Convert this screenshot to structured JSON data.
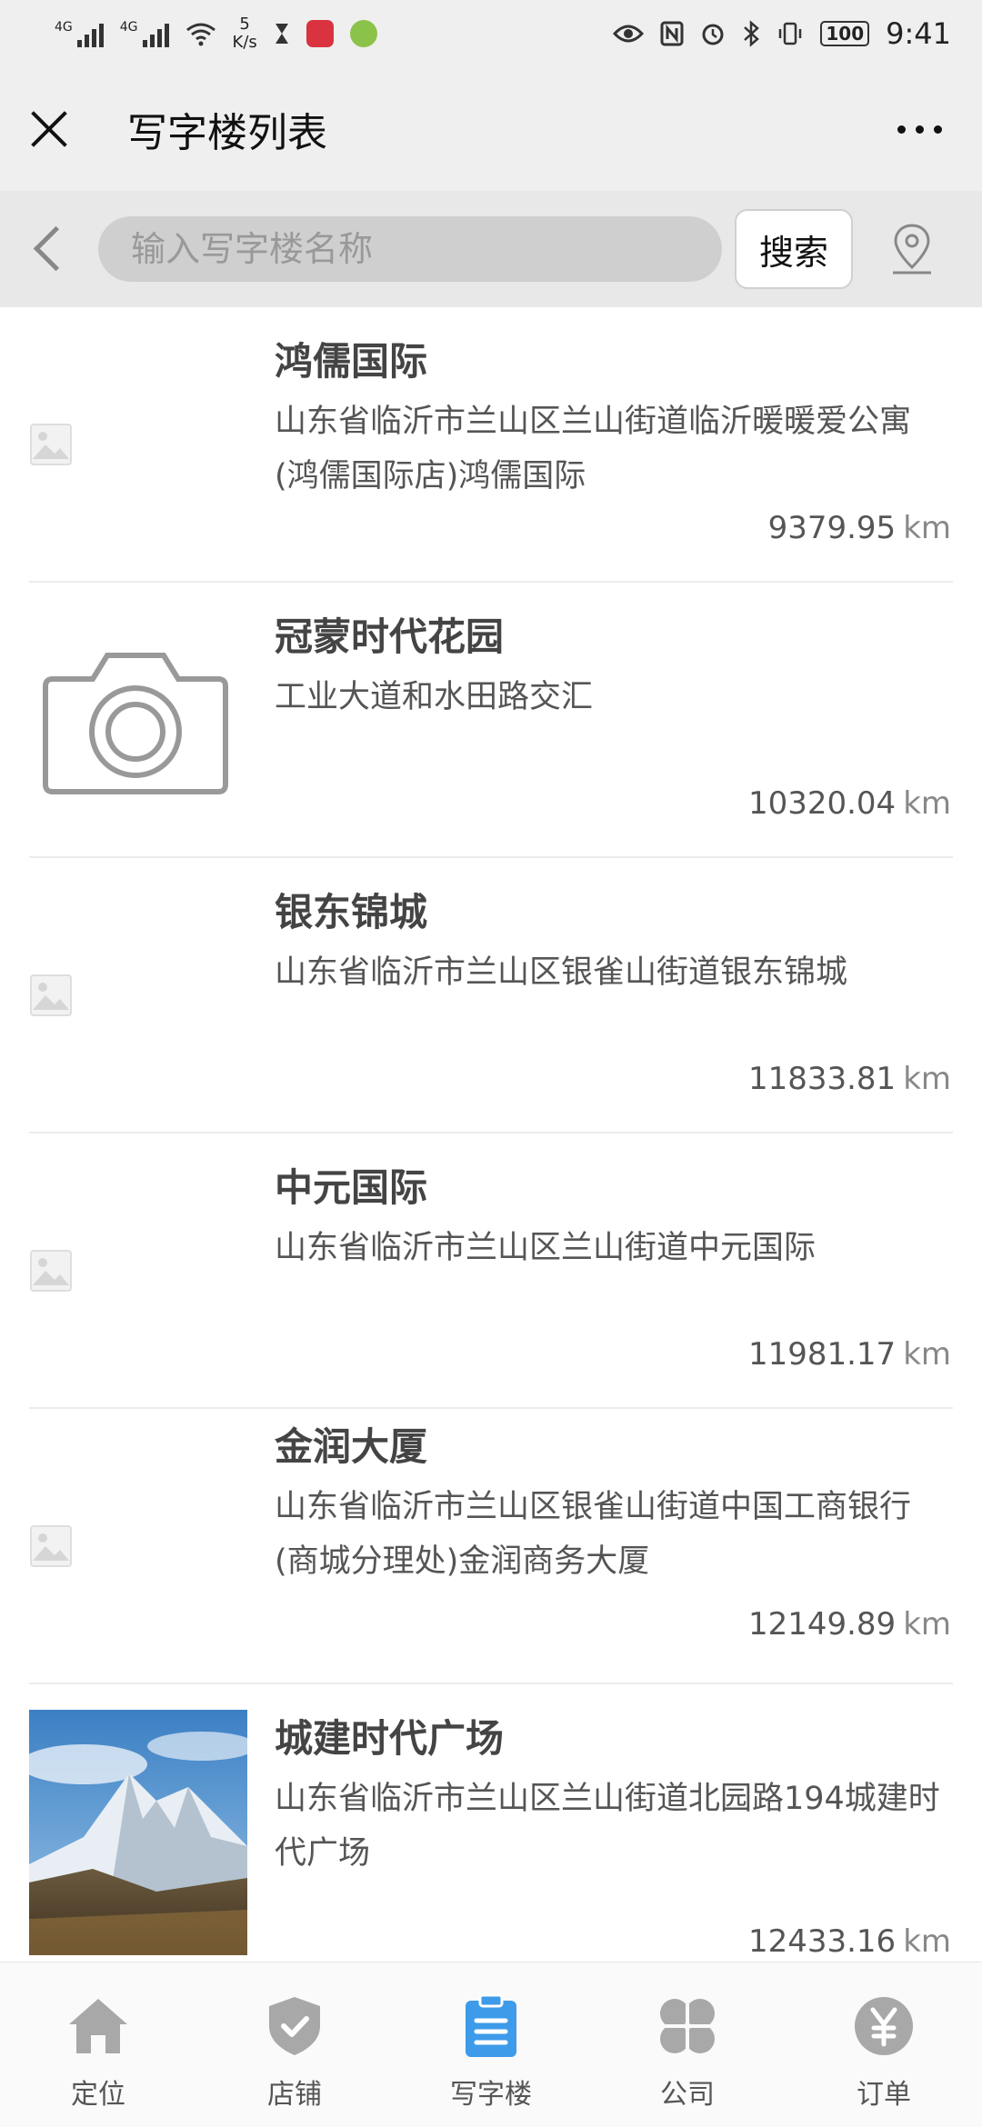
{
  "status_bar": {
    "network_1": "4G",
    "network_2": "4G",
    "speed_value": "5",
    "speed_unit": "K/s",
    "battery": "100",
    "time": "9:41"
  },
  "header": {
    "title": "写字楼列表"
  },
  "search": {
    "placeholder": "输入写字楼名称",
    "button_label": "搜索"
  },
  "buildings": [
    {
      "name": "鸿儒国际",
      "address": "山东省临沂市兰山区兰山街道临沂暖暖爱公寓(鸿儒国际店)鸿儒国际",
      "distance": "9379.95",
      "unit": "km",
      "image": "broken-image-icon"
    },
    {
      "name": "冠蒙时代花园",
      "address": "工业大道和水田路交汇",
      "distance": "10320.04",
      "unit": "km",
      "image": "camera-placeholder-icon"
    },
    {
      "name": "银东锦城",
      "address": "山东省临沂市兰山区银雀山街道银东锦城",
      "distance": "11833.81",
      "unit": "km",
      "image": "broken-image-icon"
    },
    {
      "name": "中元国际",
      "address": "山东省临沂市兰山区兰山街道中元国际",
      "distance": "11981.17",
      "unit": "km",
      "image": "broken-image-icon"
    },
    {
      "name": "金润大厦",
      "address": "山东省临沂市兰山区银雀山街道中国工商银行(商城分理处)金润商务大厦",
      "distance": "12149.89",
      "unit": "km",
      "image": "broken-image-icon"
    },
    {
      "name": "城建时代广场",
      "address": "山东省临沂市兰山区兰山街道北园路194城建时代广场",
      "distance": "12433.16",
      "unit": "km",
      "image": "mountain-photo"
    }
  ],
  "tabs": [
    {
      "label": "定位",
      "icon": "home-icon"
    },
    {
      "label": "店铺",
      "icon": "shield-check-icon"
    },
    {
      "label": "写字楼",
      "icon": "clipboard-icon",
      "active": true
    },
    {
      "label": "公司",
      "icon": "clover-icon"
    },
    {
      "label": "订单",
      "icon": "yen-icon"
    }
  ],
  "colors": {
    "active_tab": "#3d9be9",
    "inactive_tab": "#a8a8a8",
    "header_bg": "#efefef"
  }
}
